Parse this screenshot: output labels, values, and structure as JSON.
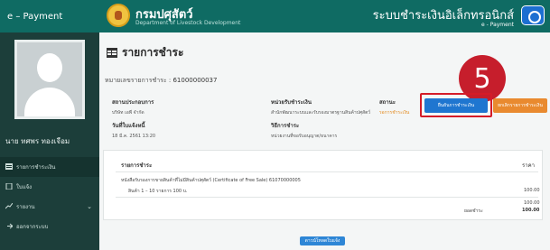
{
  "app": {
    "title": "e – Payment"
  },
  "header": {
    "department_th": "กรมปศุสัตว์",
    "department_en": "Department of Livestock Development",
    "system_title": "ระบบชำระเงินอิเล็กทรอนิกส์",
    "system_sub": "e - Payment"
  },
  "sidebar": {
    "username": "นาย ทศพร ทองเจือม",
    "items": [
      {
        "label": "รายการชำระเงิน",
        "icon": "payment-list-icon"
      },
      {
        "label": "ใบแจ้ง",
        "icon": "document-icon"
      },
      {
        "label": "รายงาน",
        "icon": "chart-icon"
      },
      {
        "label": "ออกจากระบบ",
        "icon": "logout-icon"
      }
    ]
  },
  "page": {
    "title": "รายการชำระ",
    "invoice_label": "หมายเลขรายการชำระ :",
    "invoice_number": "61000000037"
  },
  "buttons": {
    "confirm": "ยืนยันการชำระเงิน",
    "cancel": "ยกเลิกรายการชำระเงิน",
    "download": "ดาวน์โหลดใบแจ้ง"
  },
  "annotation": {
    "step": "5"
  },
  "fields": {
    "place_label": "สถานประกอบการ",
    "place_value": "บริษัท เอพี จำกัด",
    "issue_date_label": "วันที่ใบแจ้งหนี้",
    "issue_date_value": "18 มี.ค. 2561 13:20",
    "agency_label": "หน่วยรับชำระเงิน",
    "agency_value": "สำนักพัฒนาระบบและรับรองมาตรฐานสินค้าปศุสัตว์",
    "method_label": "วิธีการชำระ",
    "method_value": "หน่วยงานที่ขอรับอนุญาต/ธนาคาร",
    "status_label": "สถานะ",
    "status_value": "รอการชำระเงิน"
  },
  "items_table": {
    "header": "รายการชำระ",
    "amount_header": "ราคา",
    "rows": [
      {
        "description": "หนังสือรับรองการขายสินค้าที่ไม่มีสินค้าปศุสัตว์ (Certificate of Free Sale) 61070000005",
        "amount": ""
      },
      {
        "description": "สินค้า 1 – 10 รายการ 100 บ.",
        "amount": "100.00"
      }
    ],
    "subtotal": "100.00",
    "total_label": "ยอดชำระ",
    "total_value": "100.00"
  }
}
